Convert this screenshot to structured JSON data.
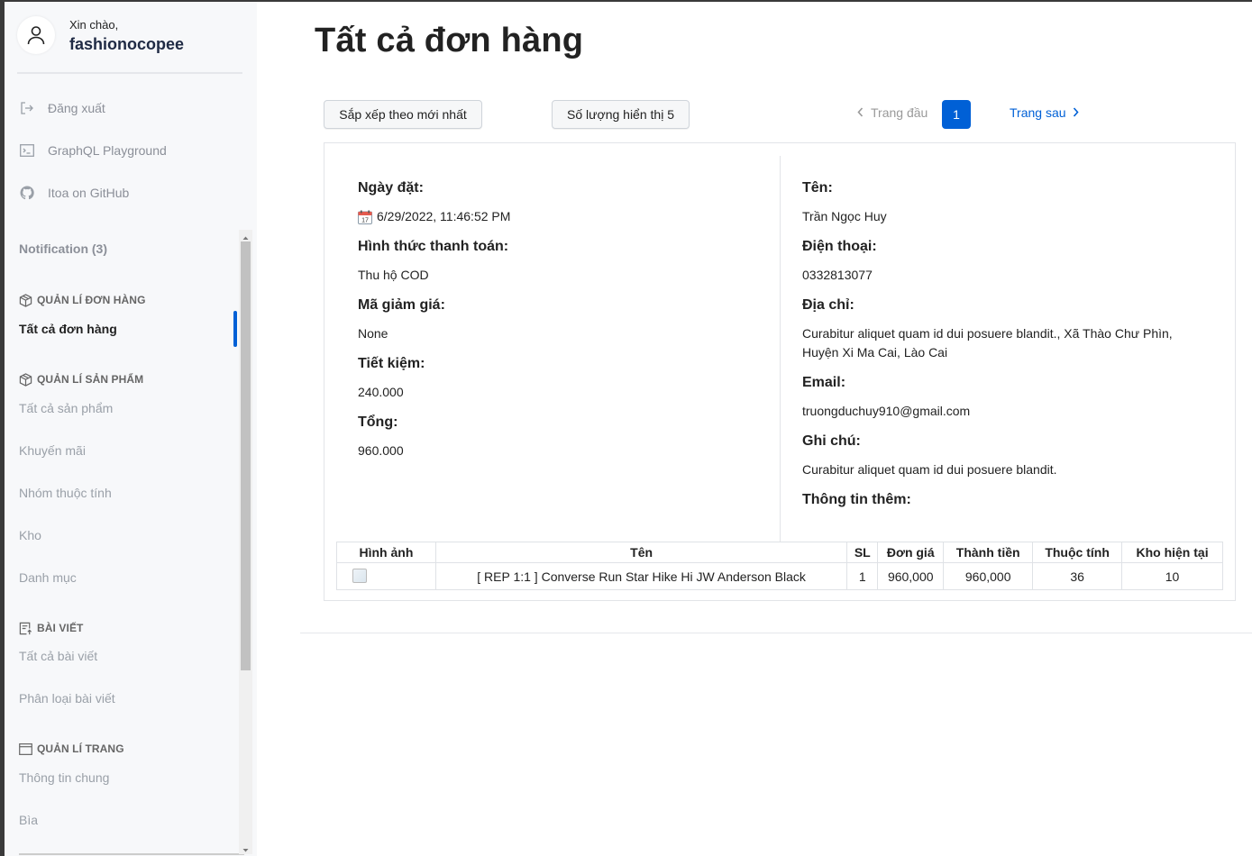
{
  "user": {
    "greeting": "Xin chào,",
    "username": "fashionocopee"
  },
  "sidebar": {
    "links": [
      {
        "label": "Đăng xuất",
        "icon": "logout-icon"
      },
      {
        "label": "GraphQL Playground",
        "icon": "terminal-icon"
      },
      {
        "label": "Itoa on GitHub",
        "icon": "github-icon"
      }
    ],
    "notification": "Notification (3)",
    "sections": [
      {
        "title": "QUẢN LÍ ĐƠN HÀNG",
        "icon": "box-icon",
        "items": [
          "Tất cả đơn hàng"
        ]
      },
      {
        "title": "QUẢN LÍ SẢN PHẨM",
        "icon": "box-icon",
        "items": [
          "Tất cả sản phẩm",
          "Khuyến mãi",
          "Nhóm thuộc tính",
          "Kho",
          "Danh mục"
        ]
      },
      {
        "title": "BÀI VIẾT",
        "icon": "post-icon",
        "items": [
          "Tất cả bài viết",
          "Phân loại bài viết"
        ]
      },
      {
        "title": "QUẢN LÍ TRANG",
        "icon": "page-icon",
        "items": [
          "Thông tin chung",
          "Bìa"
        ]
      }
    ],
    "active_item": "Tất cả đơn hàng",
    "accent": "#0060d6"
  },
  "main": {
    "title": "Tất cả đơn hàng",
    "sort_label": "Sắp xếp theo mới nhất",
    "pagesize_label": "Số lượng hiển thị 5",
    "pagination": {
      "first": "Trang đầu",
      "current": "1",
      "next": "Trang sau"
    }
  },
  "order": {
    "left": {
      "date_label": "Ngày đặt:",
      "date_value": "6/29/2022, 11:46:52 PM",
      "payment_label": "Hình thức thanh toán:",
      "payment_value": "Thu hộ COD",
      "coupon_label": "Mã giảm giá:",
      "coupon_value": "None",
      "saving_label": "Tiết kiệm:",
      "saving_value": "240.000",
      "total_label": "Tổng:",
      "total_value": "960.000"
    },
    "right": {
      "name_label": "Tên:",
      "name_value": "Trần Ngọc Huy",
      "phone_label": "Điện thoại:",
      "phone_value": "0332813077",
      "address_label": "Địa chỉ:",
      "address_line1": "Curabitur aliquet quam id dui posuere blandit., Xã Thào Chư Phìn,",
      "address_line2": "Huyện Xi Ma Cai, Lào Cai",
      "email_label": "Email:",
      "email_value": "truongduchuy910@gmail.com",
      "note_label": "Ghi chú:",
      "note_value": "Curabitur aliquet quam id dui posuere blandit.",
      "extra_label": "Thông tin thêm:"
    },
    "table": {
      "headers": [
        "Hình ảnh",
        "Tên",
        "SL",
        "Đơn giá",
        "Thành tiền",
        "Thuộc tính",
        "Kho hiện tại"
      ],
      "rows": [
        [
          "",
          "[ REP 1:1 ] Converse Run Star Hike Hi JW Anderson Black",
          "1",
          "960,000",
          "960,000",
          "36",
          "10"
        ]
      ]
    }
  }
}
